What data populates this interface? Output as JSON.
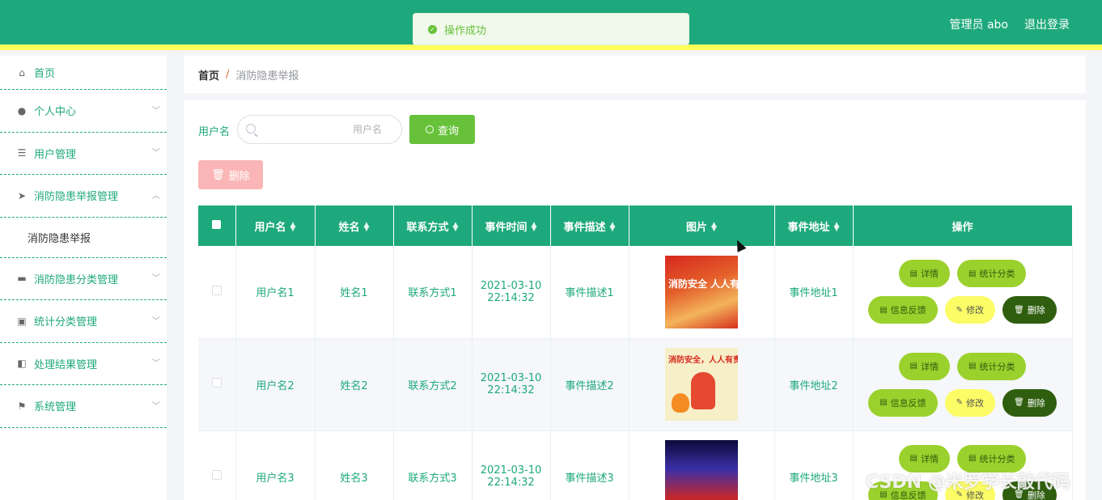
{
  "header": {
    "admin_label": "管理员 abo",
    "logout_label": "退出登录",
    "toast": "操作成功"
  },
  "sidebar": {
    "items": [
      {
        "label": "首页",
        "icon": "home-icon"
      },
      {
        "label": "个人中心",
        "icon": "user-icon"
      },
      {
        "label": "用户管理",
        "icon": "list-icon"
      },
      {
        "label": "消防隐患举报管理",
        "icon": "send-icon"
      },
      {
        "label": "消防隐患分类管理",
        "icon": "box-icon"
      },
      {
        "label": "统计分类管理",
        "icon": "clipboard-icon"
      },
      {
        "label": "处理结果管理",
        "icon": "suitcase-icon"
      },
      {
        "label": "系统管理",
        "icon": "flag-icon"
      }
    ],
    "sub_item": "消防隐患举报"
  },
  "breadcrumb": {
    "home": "首页",
    "current": "消防隐患举报"
  },
  "search": {
    "label": "用户名",
    "placeholder": "用户名",
    "query_button": "查询",
    "delete_button": "删除"
  },
  "table": {
    "headers": [
      "用户名",
      "姓名",
      "联系方式",
      "事件时间",
      "事件描述",
      "图片",
      "事件地址",
      "操作"
    ],
    "rows": [
      {
        "username": "用户名1",
        "name": "姓名1",
        "contact": "联系方式1",
        "date": "2021-03-10",
        "time": "22:14:32",
        "desc": "事件描述1",
        "pic_text": "消防安全 人人有责",
        "addr": "事件地址1"
      },
      {
        "username": "用户名2",
        "name": "姓名2",
        "contact": "联系方式2",
        "date": "2021-03-10",
        "time": "22:14:32",
        "desc": "事件描述2",
        "pic_text": "消防安全，人人有责",
        "addr": "事件地址2"
      },
      {
        "username": "用户名3",
        "name": "姓名3",
        "contact": "联系方式3",
        "date": "2021-03-10",
        "time": "22:14:32",
        "desc": "事件描述3",
        "pic_text": "",
        "addr": "事件地址3"
      }
    ],
    "ops": {
      "detail": "详情",
      "stat": "统计分类",
      "feedback": "信息反馈",
      "edit": "修改",
      "delete": "删除"
    }
  },
  "watermark": "CSDN @米罗学长敲代码",
  "colors": {
    "primary": "#1ea97c",
    "accent_yellow": "#ffff5a",
    "query_green": "#67c23a",
    "delete_pink": "#fab6b6"
  }
}
